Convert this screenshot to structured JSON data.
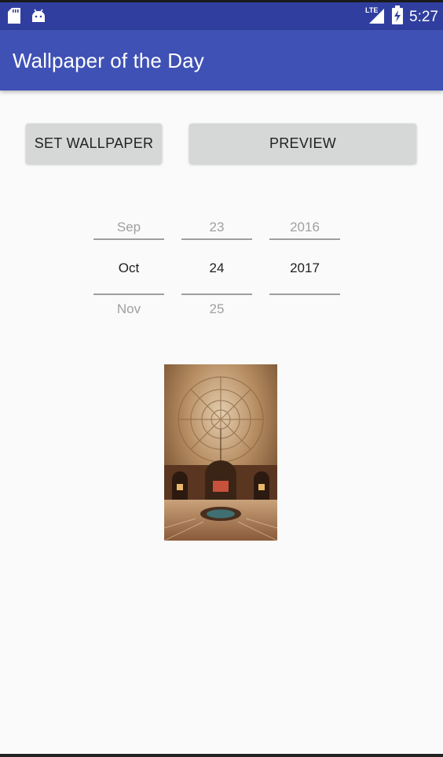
{
  "status_bar": {
    "time": "5:27",
    "network_label": "LTE",
    "icons": [
      "sd-card-icon",
      "android-icon",
      "lte-signal-icon",
      "battery-charging-icon"
    ]
  },
  "app_bar": {
    "title": "Wallpaper of the Day"
  },
  "actions": {
    "set_wallpaper_label": "SET WALLPAPER",
    "preview_label": "PREVIEW"
  },
  "date_picker": {
    "month": {
      "prev": "Sep",
      "current": "Oct",
      "next": "Nov"
    },
    "day": {
      "prev": "23",
      "current": "24",
      "next": "25"
    },
    "year": {
      "prev": "2016",
      "current": "2017",
      "next": ""
    }
  },
  "colors": {
    "app_bar": "#3f51b5",
    "status_bar": "#303f9f",
    "button_bg": "#d6d7d7",
    "background": "#fafafa"
  }
}
